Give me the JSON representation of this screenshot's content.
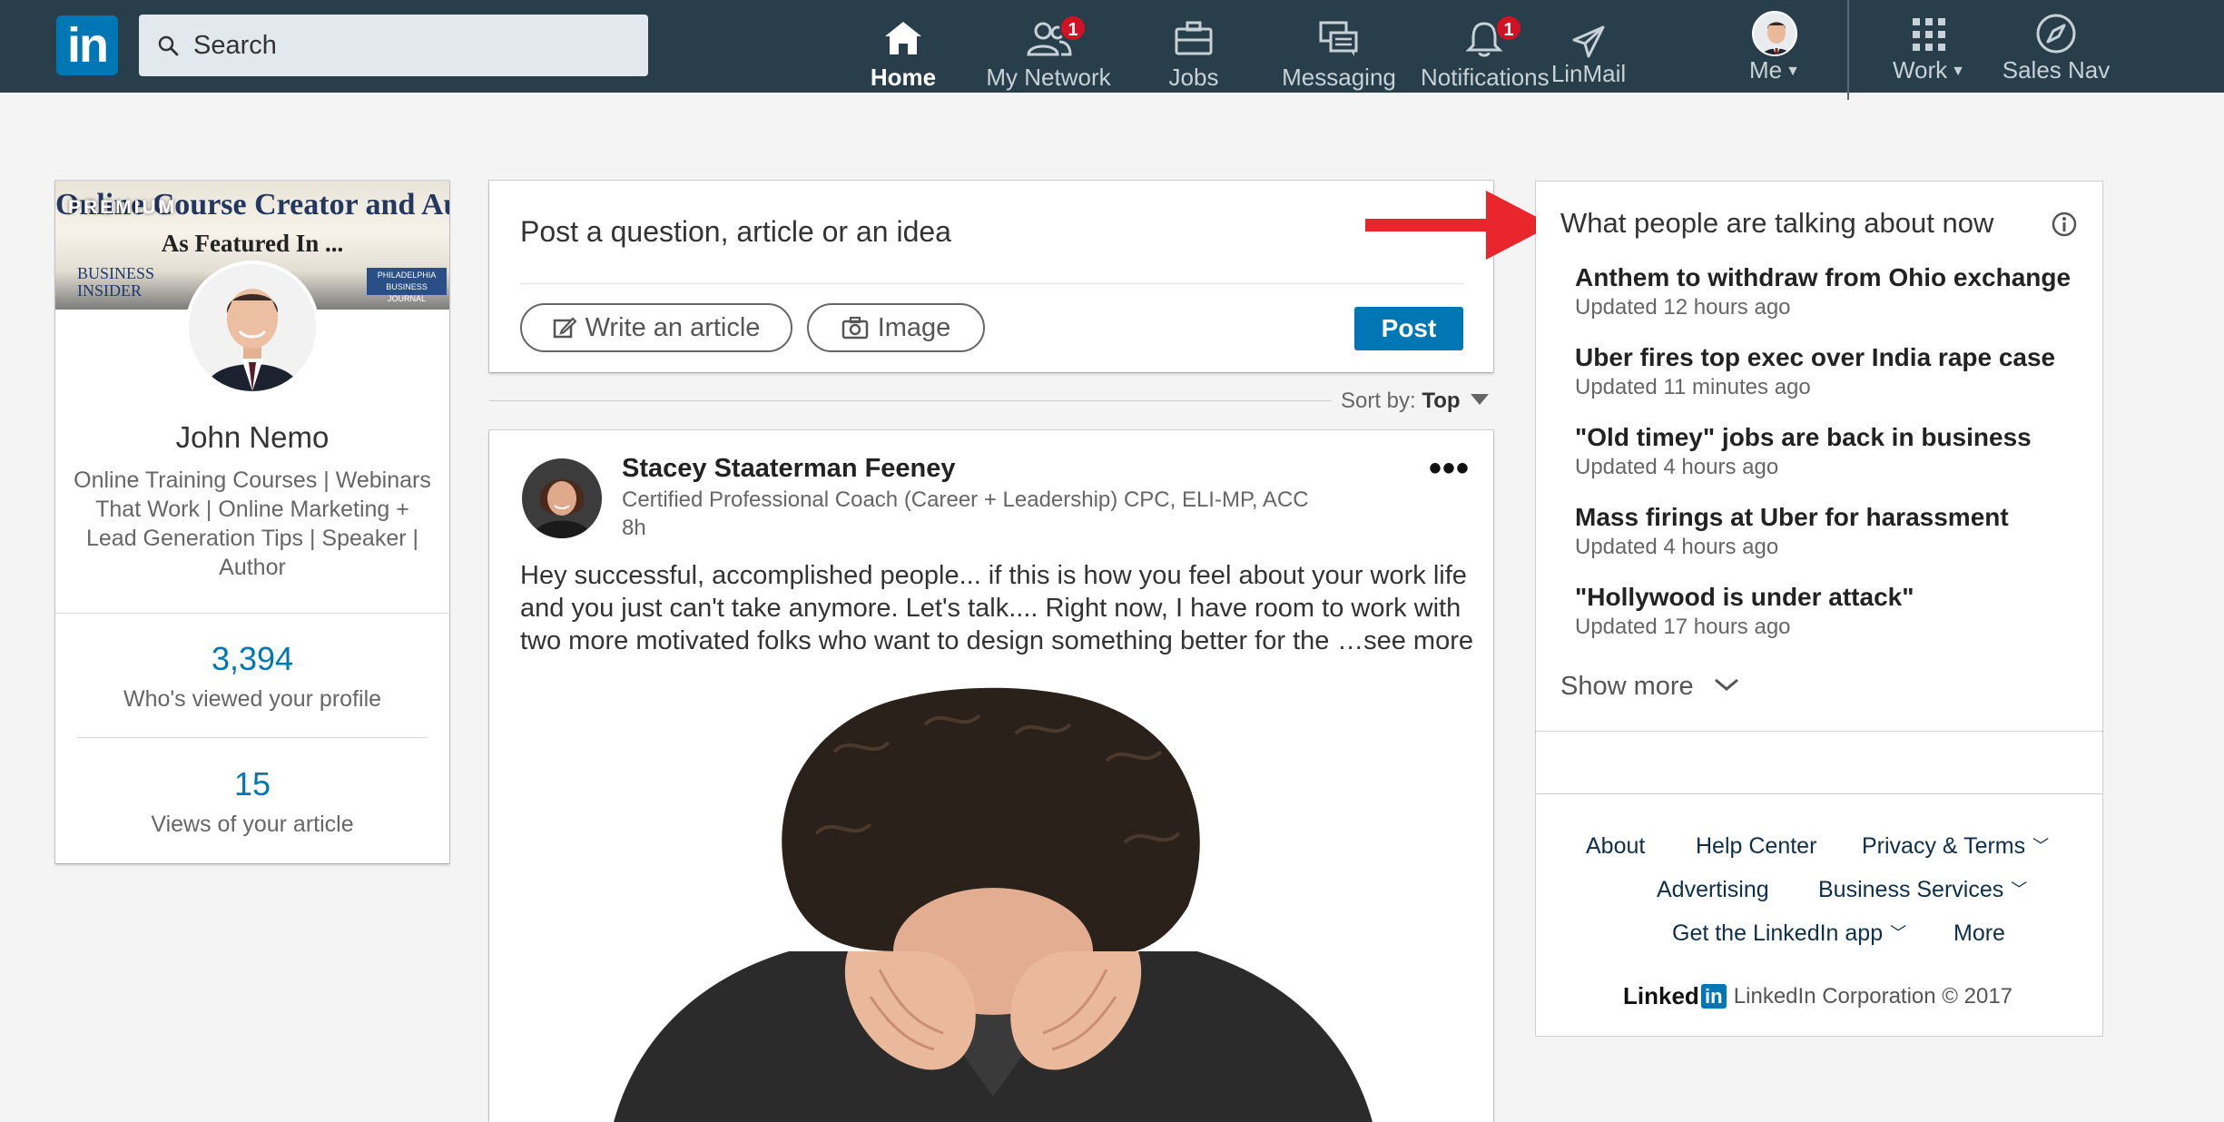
{
  "topnav": {
    "search_placeholder": "Search",
    "items": [
      {
        "label": "Home",
        "icon": "home-icon"
      },
      {
        "label": "My Network",
        "icon": "network-icon",
        "badge": "1"
      },
      {
        "label": "Jobs",
        "icon": "briefcase-icon"
      },
      {
        "label": "Messaging",
        "icon": "messaging-icon"
      },
      {
        "label": "Notifications",
        "icon": "bell-icon",
        "badge": "1"
      },
      {
        "label": "LinMail",
        "icon": "send-icon"
      },
      {
        "label": "Me",
        "icon": "avatar"
      },
      {
        "label": "Work",
        "icon": "grid-icon"
      },
      {
        "label": "Sales Nav",
        "icon": "compass-icon"
      }
    ],
    "colors": {
      "bar": "#283e4a",
      "badge": "#d11124",
      "brand": "#0077b5"
    }
  },
  "profile": {
    "banner_title": "Online Course Creator and Author",
    "banner_subtitle": "As Featured In ...",
    "banner_logo_1": "BUSINESS INSIDER",
    "banner_logo_2": "PHILADELPHIA BUSINESS JOURNAL",
    "premium_label": "PREMIUM",
    "name": "John Nemo",
    "headline": "Online Training Courses | Webinars That Work | Online Marketing + Lead Generation Tips | Speaker | Author",
    "stat1_value": "3,394",
    "stat1_label": "Who's viewed your profile",
    "stat2_value": "15",
    "stat2_label": "Views of your article"
  },
  "share": {
    "prompt": "Post a question, article or an idea",
    "write_article": "Write an article",
    "image": "Image",
    "post": "Post",
    "sort_label": "Sort by:",
    "sort_value": "Top"
  },
  "post": {
    "author": "Stacey Staaterman Feeney",
    "author_title": "Certified Professional Coach (Career + Leadership) CPC, ELI-MP, ACC",
    "time": "8h",
    "text": "Hey successful, accomplished people... if this is how you feel about your work life and you just can't take anymore. Let's talk.... Right now, I have room to work with two more motivated folks who want to design something better for the",
    "see_more": "…see more"
  },
  "news": {
    "title": "What people are talking about now",
    "items": [
      {
        "headline": "Anthem to withdraw from Ohio exchange",
        "updated": "Updated 12 hours ago"
      },
      {
        "headline": "Uber fires top exec over India rape case",
        "updated": "Updated 11 minutes ago"
      },
      {
        "headline": "\"Old timey\" jobs are back in business",
        "updated": "Updated 4 hours ago"
      },
      {
        "headline": "Mass firings at Uber for harassment",
        "updated": "Updated 4 hours ago"
      },
      {
        "headline": "\"Hollywood is under attack\"",
        "updated": "Updated 17 hours ago"
      }
    ],
    "show_more": "Show more"
  },
  "footer": {
    "links": [
      "About",
      "Help Center",
      "Privacy & Terms",
      "Advertising",
      "Business Services",
      "Get the LinkedIn app",
      "More"
    ],
    "brand": "Linked",
    "brand_in": "in",
    "copyright": "LinkedIn Corporation © 2017"
  }
}
